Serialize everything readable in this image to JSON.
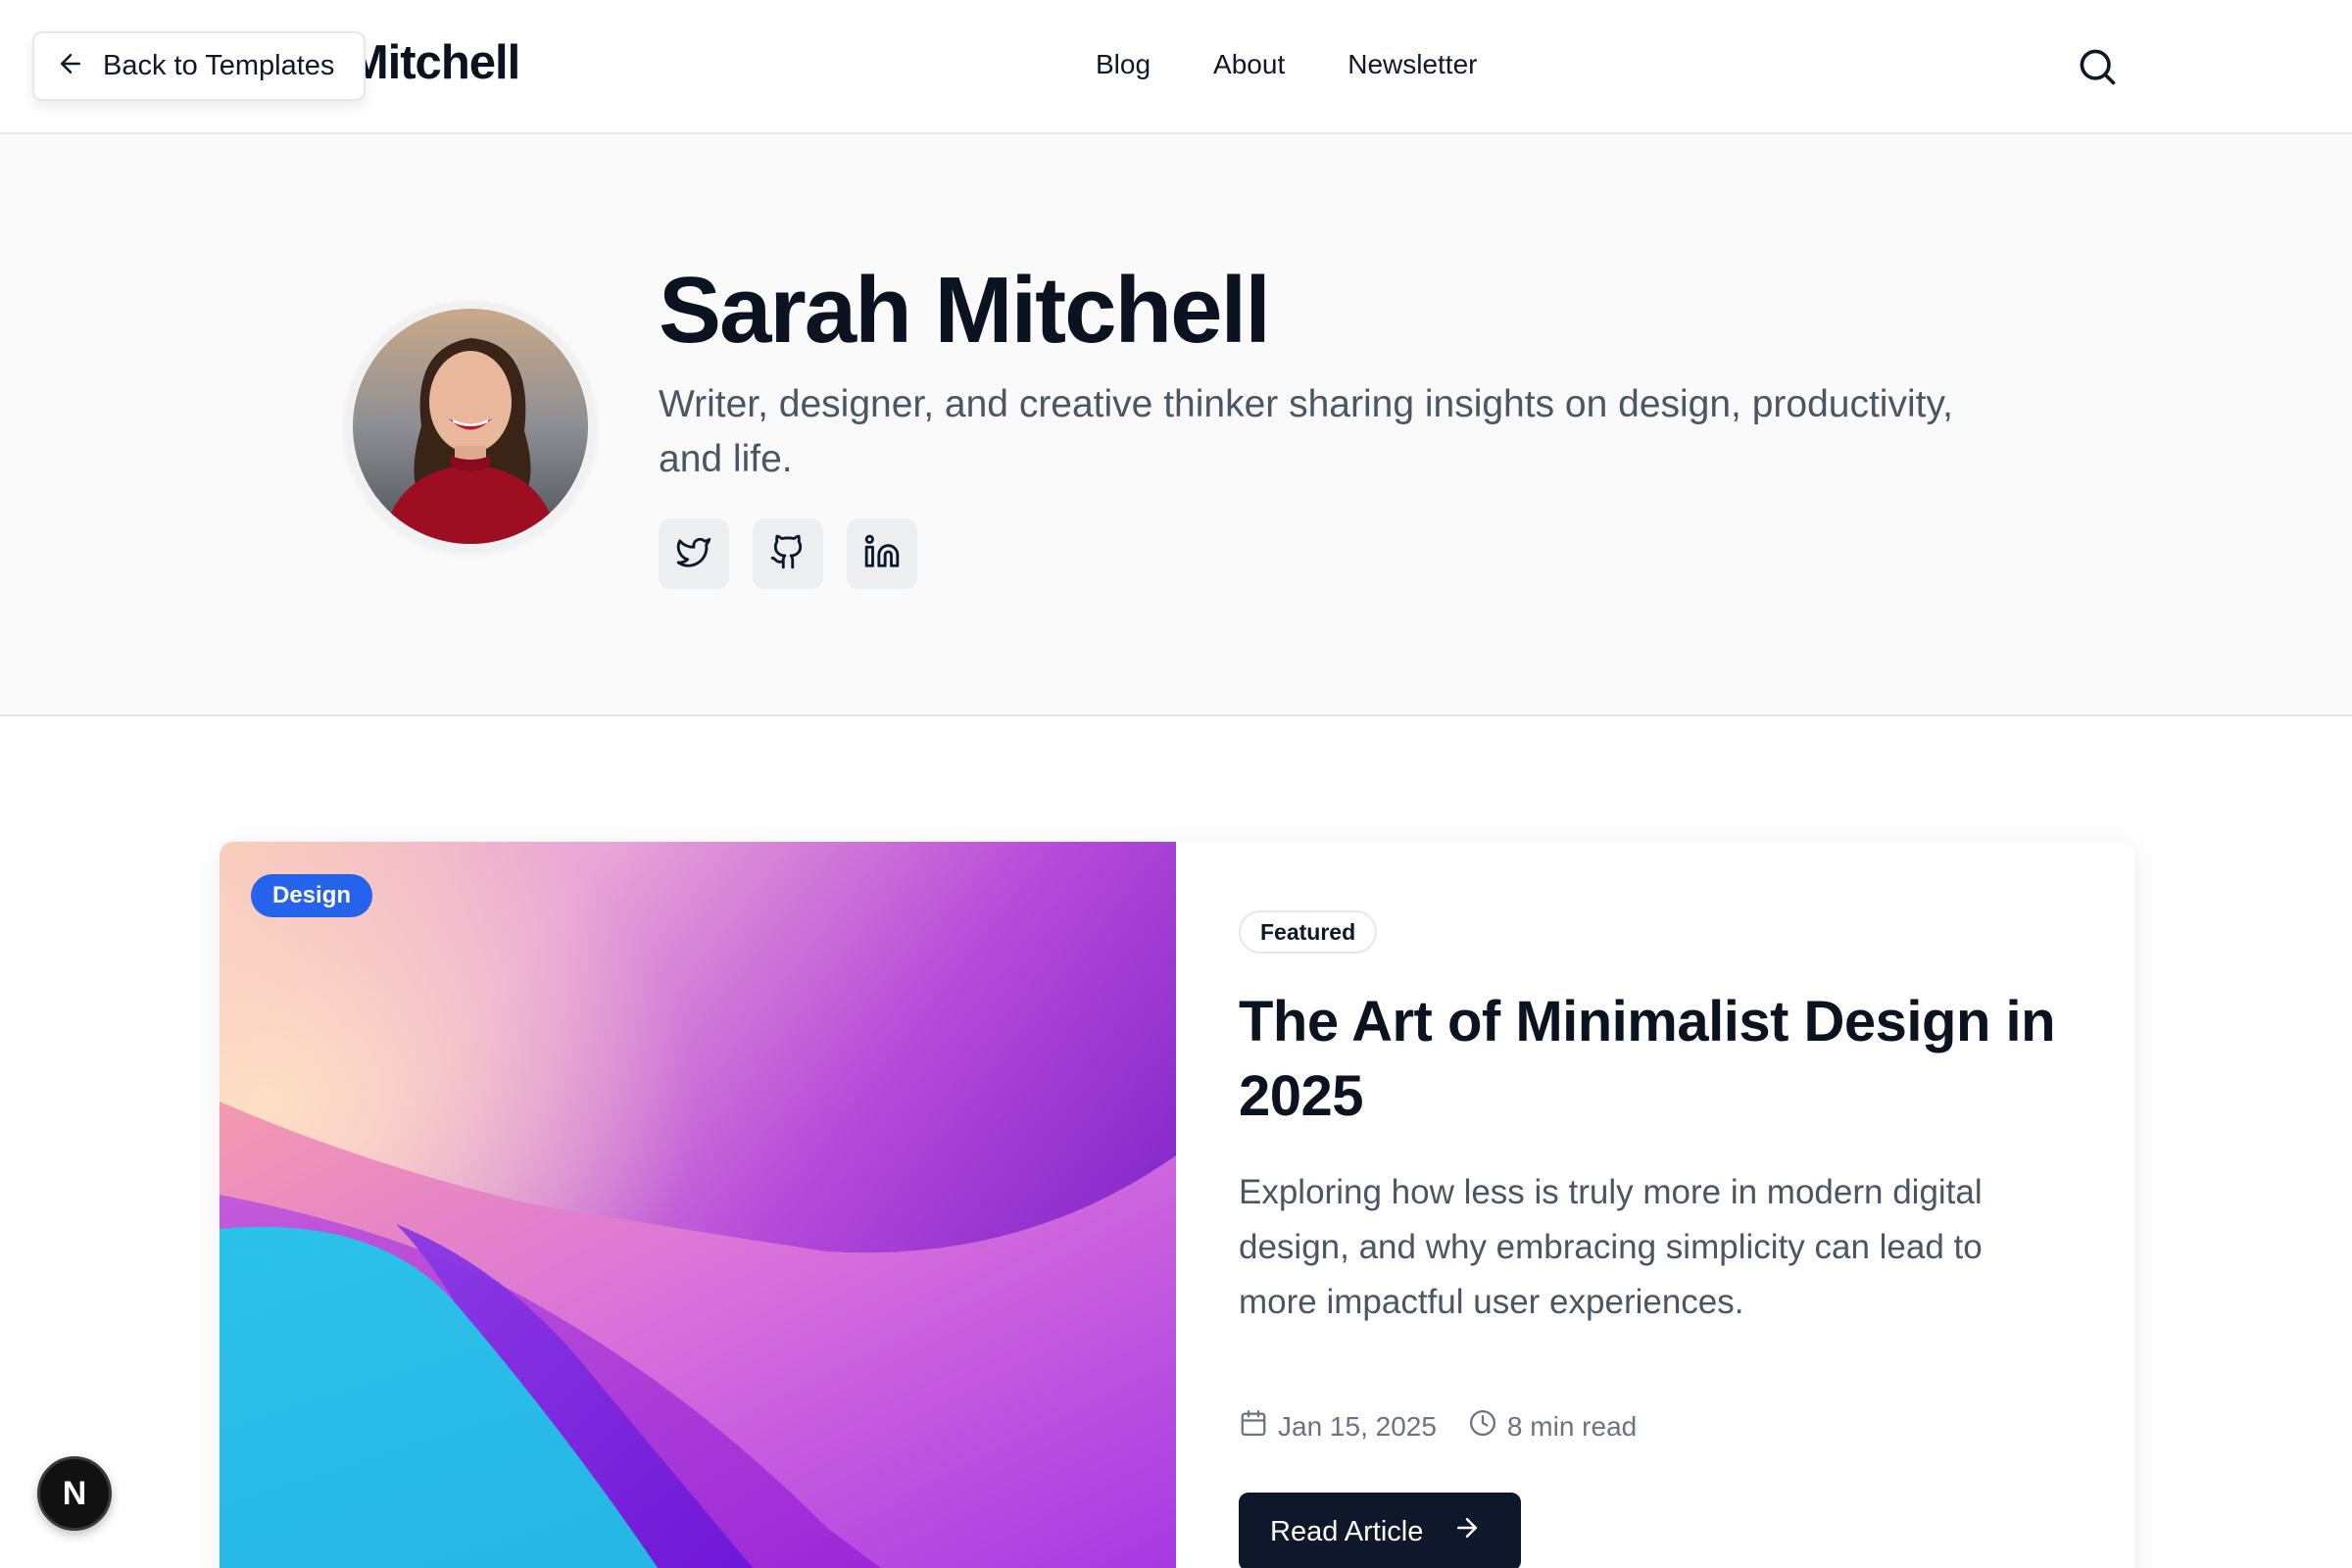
{
  "header": {
    "brand_visible": "Mitchell",
    "back_button_label": "Back to Templates",
    "nav": [
      "Blog",
      "About",
      "Newsletter"
    ]
  },
  "hero": {
    "name": "Sarah Mitchell",
    "bio": "Writer, designer, and creative thinker sharing insights on design, productivity, and life.",
    "social_icons": [
      "twitter-icon",
      "github-icon",
      "linkedin-icon"
    ]
  },
  "featured_post": {
    "category": "Design",
    "pill": "Featured",
    "title": "The Art of Minimalist Design in 2025",
    "excerpt": "Exploring how less is truly more in modern digital design, and why embracing simplicity can lead to more impactful user experiences.",
    "date": "Jan 15, 2025",
    "read_time": "8 min read",
    "cta": "Read Article"
  },
  "fab": {
    "label": "N"
  },
  "colors": {
    "accent_blue": "#2563eb",
    "dark": "#0f172a",
    "muted_text": "#4b5563"
  }
}
